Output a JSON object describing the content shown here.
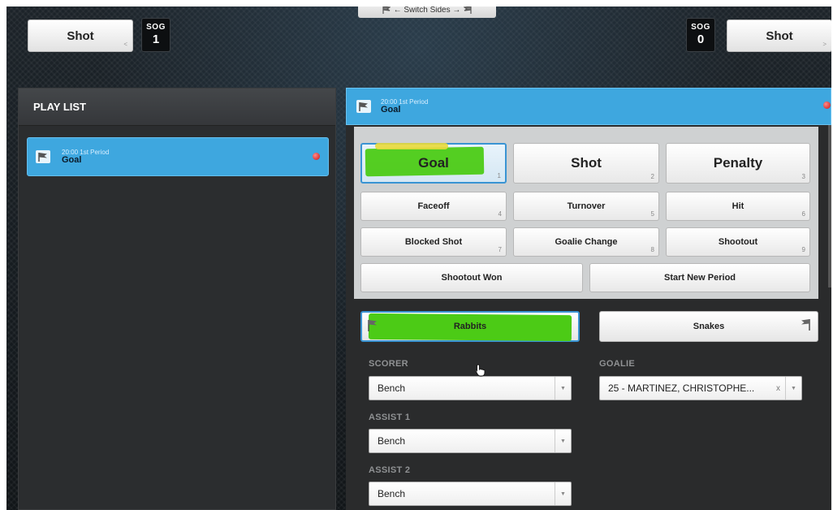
{
  "top_bar": {
    "left_shot_label": "Shot",
    "left_shot_hint": "<",
    "left_sog_label": "SOG",
    "left_sog_value": "1",
    "right_sog_label": "SOG",
    "right_sog_value": "0",
    "right_shot_label": "Shot",
    "right_shot_hint": ">",
    "switch_sides_label": "← Switch Sides →"
  },
  "playlist": {
    "title": "PLAY LIST",
    "items": [
      {
        "time": "20:00 1st Period",
        "name": "Goal"
      }
    ]
  },
  "event": {
    "header_time": "20:00 1st Period",
    "header_name": "Goal",
    "types_row1": [
      {
        "label": "Goal",
        "key": "1"
      },
      {
        "label": "Shot",
        "key": "2"
      },
      {
        "label": "Penalty",
        "key": "3"
      }
    ],
    "types_row2": [
      {
        "label": "Faceoff",
        "key": "4"
      },
      {
        "label": "Turnover",
        "key": "5"
      },
      {
        "label": "Hit",
        "key": "6"
      }
    ],
    "types_row3": [
      {
        "label": "Blocked Shot",
        "key": "7"
      },
      {
        "label": "Goalie Change",
        "key": "8"
      },
      {
        "label": "Shootout",
        "key": "9"
      }
    ],
    "types_row4": [
      {
        "label": "Shootout Won"
      },
      {
        "label": "Start New Period"
      }
    ],
    "teams": {
      "home": "Rabbits",
      "away": "Snakes"
    },
    "fields": {
      "scorer_label": "SCORER",
      "scorer_value": "Bench",
      "goalie_label": "GOALIE",
      "goalie_value": "25 - MARTINEZ, CHRISTOPHE...",
      "goalie_clear": "x",
      "assist1_label": "ASSIST 1",
      "assist1_value": "Bench",
      "assist2_label": "ASSIST 2",
      "assist2_value": "Bench"
    }
  },
  "colors": {
    "accent_blue": "#3ea7df",
    "highlight_green": "#4ccb16",
    "status_red": "#cc1010"
  }
}
